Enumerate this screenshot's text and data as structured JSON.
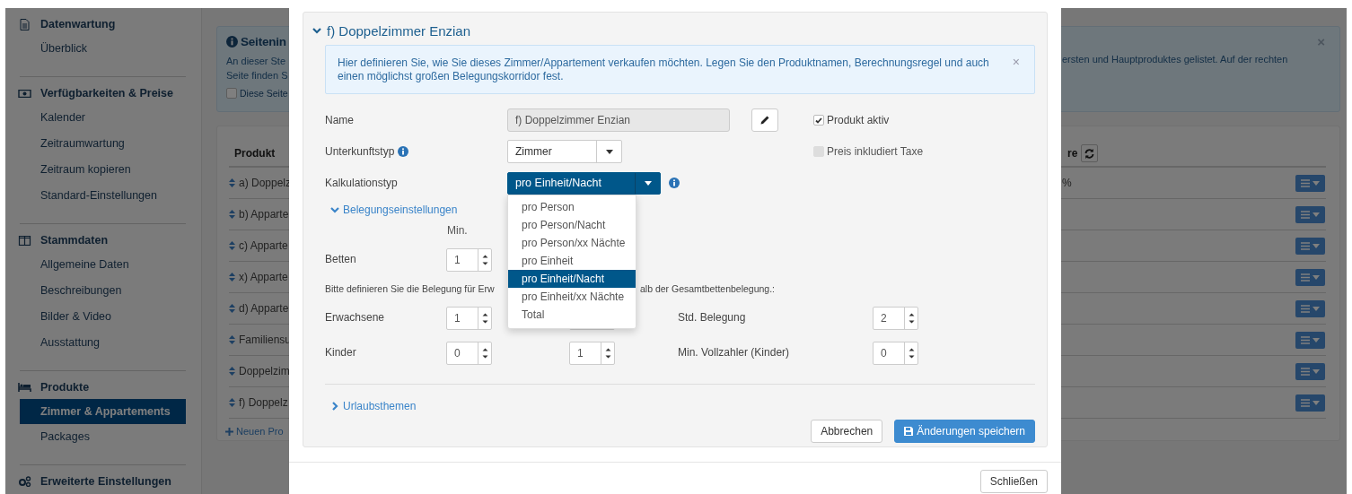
{
  "sidebar": {
    "sections": [
      {
        "title": "Datenwartung",
        "items": [
          {
            "label": "Überblick",
            "selected": false
          }
        ]
      },
      {
        "title": "Verfügbarkeiten & Preise",
        "items": [
          {
            "label": "Kalender",
            "selected": false
          },
          {
            "label": "Zeitraumwartung",
            "selected": false
          },
          {
            "label": "Zeitraum kopieren",
            "selected": false
          },
          {
            "label": "Standard-Einstellungen",
            "selected": false
          }
        ]
      },
      {
        "title": "Stammdaten",
        "items": [
          {
            "label": "Allgemeine Daten",
            "selected": false
          },
          {
            "label": "Beschreibungen",
            "selected": false
          },
          {
            "label": "Bilder & Video",
            "selected": false
          },
          {
            "label": "Ausstattung",
            "selected": false
          }
        ]
      },
      {
        "title": "Produkte",
        "items": [
          {
            "label": "Zimmer & Appartements",
            "selected": true
          },
          {
            "label": "Packages",
            "selected": false
          }
        ]
      },
      {
        "title": "Erweiterte Einstellungen"
      }
    ]
  },
  "info_box": {
    "title": "Seitenin",
    "lines": [
      "An dieser Ste",
      "Seite finden S"
    ],
    "right_text": "ersten und Hauptproduktes gelistet. Auf der rechten",
    "close": "×",
    "checkbox": {
      "label": "Diese Seite",
      "checked": false
    }
  },
  "table": {
    "columns": [
      "Produkt",
      "re"
    ],
    "rows": [
      {
        "product": "a) Doppelz",
        "column_2": "%"
      },
      {
        "product": "b) Apparte"
      },
      {
        "product": "c) Apparte"
      },
      {
        "product": "x) Apparte"
      },
      {
        "product": "d) Apparte"
      },
      {
        "product": "Familiensu"
      },
      {
        "product": "Doppelzim"
      },
      {
        "product": "f) Doppelz"
      }
    ],
    "add_link": "Neuen Pro"
  },
  "modal": {
    "panel_title": "f) Doppelzimmer Enzian",
    "expanded": true,
    "alert": {
      "text": "Hier definieren Sie, wie Sie dieses Zimmer/Appartement verkaufen möchten. Legen Sie den Produktnamen, Berechnungsregel und auch einen möglichst großen Belegungskorridor fest.",
      "close": "×"
    },
    "name": {
      "label": "Name",
      "value": "f) Doppelzimmer Enzian",
      "disabled": true
    },
    "checkboxes": [
      {
        "label": "Produkt aktiv",
        "checked": true,
        "disabled": false
      },
      {
        "label": "Preis inkludiert Taxe",
        "checked": false,
        "disabled": true
      }
    ],
    "accommodation_type": {
      "label": "Unterkunftstyp",
      "value": "Zimmer"
    },
    "calculation_type": {
      "label": "Kalkulationstyp",
      "value": "pro Einheit/Nacht",
      "open": true,
      "options": [
        {
          "label": "pro Person",
          "selected": false
        },
        {
          "label": "pro Person/Nacht",
          "selected": false
        },
        {
          "label": "pro Person/xx Nächte",
          "selected": false
        },
        {
          "label": "pro Einheit",
          "selected": false
        },
        {
          "label": "pro Einheit/Nacht",
          "selected": true
        },
        {
          "label": "pro Einheit/xx Nächte",
          "selected": false
        },
        {
          "label": "Total",
          "selected": false
        }
      ]
    },
    "occupancy": {
      "title": "Belegungseinstellungen",
      "expanded": true,
      "column_1": "Min.",
      "beds": {
        "label": "Betten",
        "min": "1"
      },
      "hint_start": "Bitte definieren Sie die Belegung für Erw",
      "hint_end": "alb der Gesamtbettenbelegung.:",
      "rows": [
        {
          "label": "Erwachsene",
          "min": "1",
          "max_spinner": true,
          "extra_label": "Std. Belegung",
          "extra_value": "2"
        },
        {
          "label": "Kinder",
          "min": "0",
          "max_spinner": true,
          "max": "1",
          "extra_label": "Min. Vollzahler (Kinder)",
          "extra_value": "0"
        }
      ]
    },
    "themes": {
      "title": "Urlaubsthemen",
      "expanded": false
    },
    "cancel_button": "Abbrechen",
    "save_button": "Änderungen speichern",
    "footer_button": "Schließen"
  }
}
